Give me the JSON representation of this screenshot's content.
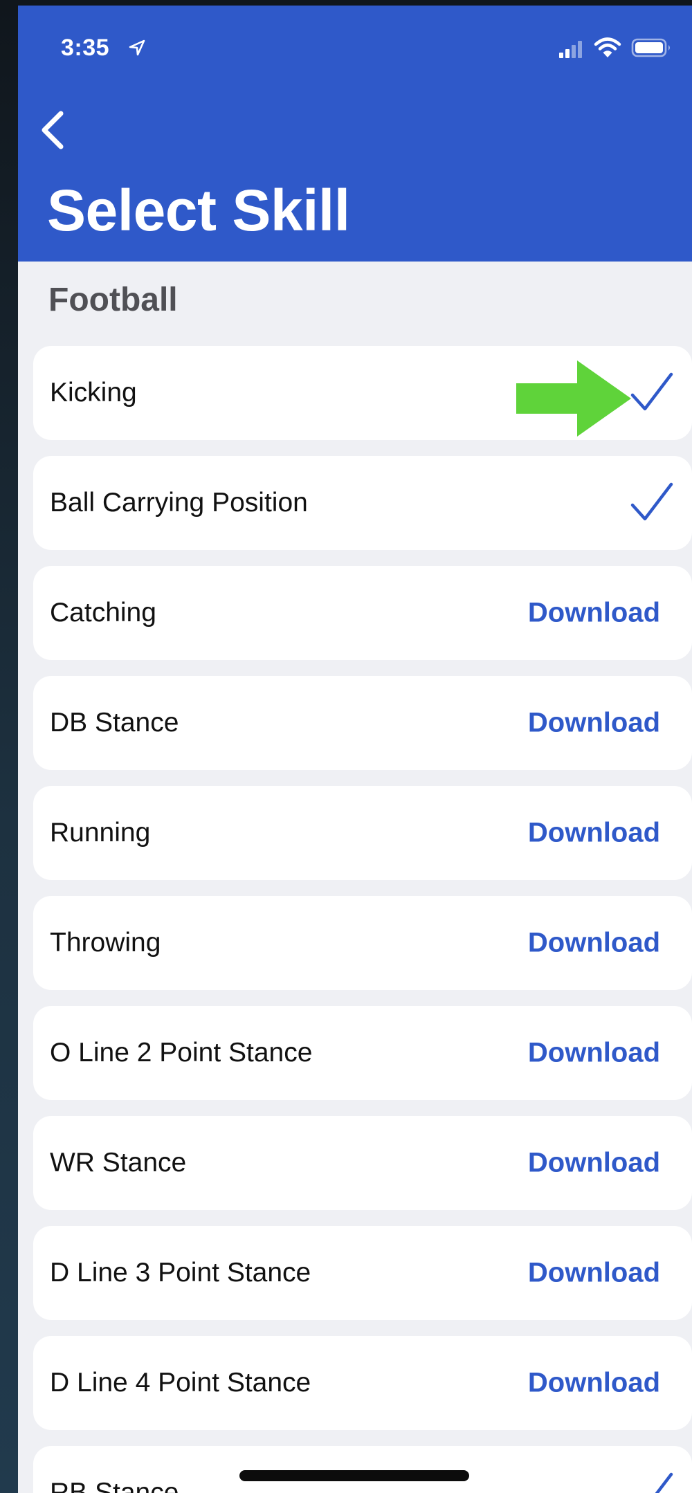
{
  "status_bar": {
    "time": "3:35",
    "icons": [
      "location-arrow-icon",
      "cellular-signal-icon",
      "wifi-icon",
      "battery-icon"
    ]
  },
  "nav": {
    "back_icon": "chevron-left-icon",
    "title": "Select Skill"
  },
  "section": {
    "title": "Football"
  },
  "skills": [
    {
      "name": "Kicking",
      "status": "downloaded",
      "action": ""
    },
    {
      "name": "Ball Carrying Position",
      "status": "downloaded",
      "action": ""
    },
    {
      "name": "Catching",
      "status": "available",
      "action": "Download"
    },
    {
      "name": "DB Stance",
      "status": "available",
      "action": "Download"
    },
    {
      "name": "Running",
      "status": "available",
      "action": "Download"
    },
    {
      "name": "Throwing",
      "status": "available",
      "action": "Download"
    },
    {
      "name": "O Line 2 Point Stance",
      "status": "available",
      "action": "Download"
    },
    {
      "name": "WR Stance",
      "status": "available",
      "action": "Download"
    },
    {
      "name": "D Line 3 Point Stance",
      "status": "available",
      "action": "Download"
    },
    {
      "name": "D Line 4 Point Stance",
      "status": "available",
      "action": "Download"
    },
    {
      "name": "RB Stance",
      "status": "downloaded",
      "action": ""
    }
  ],
  "annotation": {
    "icon": "right-arrow-icon",
    "color": "#5fd33a"
  },
  "colors": {
    "accent": "#2f59c9",
    "background": "#eff0f4",
    "row": "#ffffff"
  }
}
